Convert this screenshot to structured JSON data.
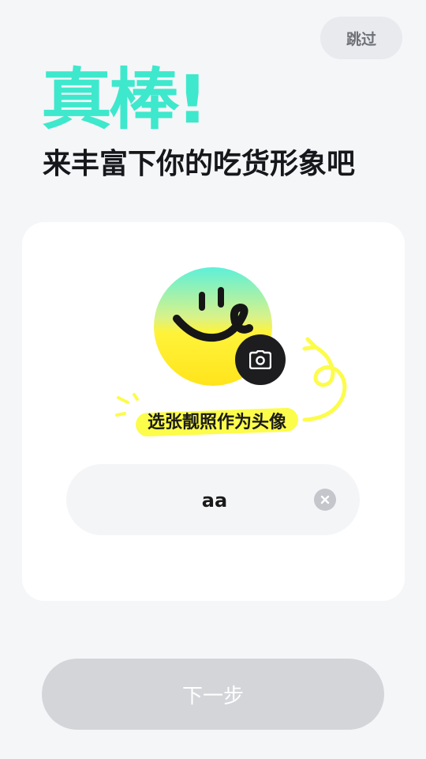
{
  "header": {
    "skip_label": "跳过",
    "hero_title": "真棒!",
    "subtitle": "来丰富下你的吃货形象吧"
  },
  "profile_card": {
    "avatar": {
      "icon": "smiley-face-icon",
      "colors": {
        "top": "#5ef0d8",
        "bottom": "#fff33a",
        "ink": "#161616"
      }
    },
    "camera_icon": "camera-icon",
    "photo_hint": "选张靓照作为头像",
    "nickname": {
      "value": "aa",
      "clear_icon": "clear-icon"
    }
  },
  "footer": {
    "next_label": "下一步"
  },
  "colors": {
    "accent": "#3ee8cc",
    "highlight": "#fcfc4b",
    "button_disabled": "#d3d5d9"
  }
}
